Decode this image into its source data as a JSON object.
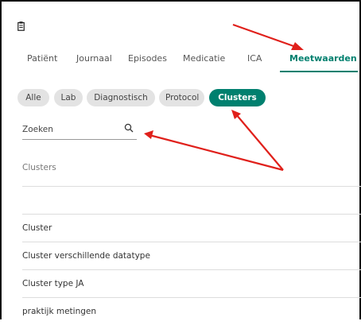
{
  "tabs": [
    {
      "label": "Patiënt"
    },
    {
      "label": "Journaal"
    },
    {
      "label": "Episodes"
    },
    {
      "label": "Medicatie"
    },
    {
      "label": "ICA"
    },
    {
      "label": "Meetwaarden"
    }
  ],
  "active_tab": "Meetwaarden",
  "filters": [
    {
      "label": "Alle"
    },
    {
      "label": "Lab"
    },
    {
      "label": "Diagnostisch"
    },
    {
      "label": "Protocol"
    },
    {
      "label": "Clusters"
    }
  ],
  "active_filter": "Clusters",
  "search": {
    "placeholder": "Zoeken"
  },
  "list": {
    "header": "Clusters",
    "items": [
      {
        "label": "Cluster"
      },
      {
        "label": "Cluster verschillende datatype"
      },
      {
        "label": "Cluster type JA"
      },
      {
        "label": "praktijk metingen"
      }
    ]
  },
  "colors": {
    "accent": "#00806f",
    "annotation_arrow": "#e0201b"
  },
  "icons": {
    "top_left": "clipboard-icon",
    "search": "search-icon"
  }
}
